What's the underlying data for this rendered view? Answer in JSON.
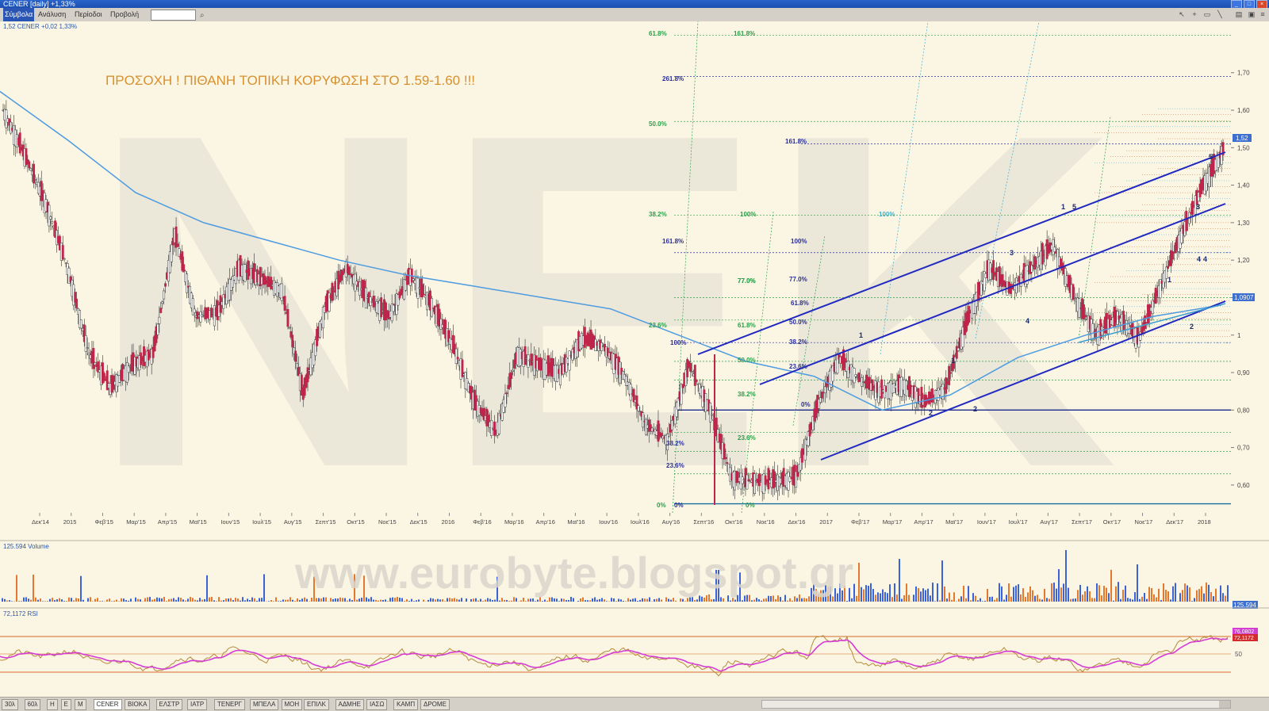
{
  "window": {
    "title": "CENER [daily] +1,33%"
  },
  "menu": {
    "items": [
      "Σύμβολα",
      "Ανάλυση",
      "Περίοδοι",
      "Προβολή"
    ]
  },
  "price_panel": {
    "legend": "1,52 CENER +0,02 1,33%",
    "annotation": "ΠΡΟΣΟΧΗ !    ΠΙΘΑΝΗ ΤΟΠΙΚΗ ΚΟΡΥΦΩΣΗ ΣΤΟ 1.59-1.60 !!!",
    "watermark": "NEK",
    "last_price_tag": "1,52",
    "ma_price_tag": "1,0907"
  },
  "volume_panel": {
    "legend": "125.594 Volume",
    "value_tag": "125.594"
  },
  "rsi_panel": {
    "legend": "72,1172 RSI",
    "value_tag1": "76,0802",
    "value_tag2": "72,1172",
    "axis_label": "50"
  },
  "site_watermark": "www.eurobyte.blogspot.gr",
  "tabs": [
    "30λ",
    "60λ",
    "H",
    "E",
    "M",
    "CENER",
    "ΒΙΟΚΑ",
    "ΕΛΣΤΡ",
    "ΙΑΤΡ",
    "ΤΕΝΕΡΓ",
    "ΜΠΕΛΑ",
    "ΜΟΗ",
    "ΕΠΙΛΚ",
    "ΑΔΜΗΕ",
    "ΙΑΣΩ",
    "ΚΑΜΠ",
    "ΔΡΟΜΕ"
  ],
  "chart_data": {
    "type": "line",
    "price_axis": {
      "ticks": [
        "1,70",
        "1,60",
        "1,50",
        "1,40",
        "1,30",
        "1,20",
        "1,10",
        "1",
        "0,90",
        "0,80",
        "0,70",
        "0,60"
      ],
      "ylim": [
        0.53,
        1.82
      ]
    },
    "x_ticks": [
      "Δεκ'14",
      "2015",
      "Φεβ'15",
      "Μαρ'15",
      "Απρ'15",
      "Μαϊ'15",
      "Ιουν'15",
      "Ιουλ'15",
      "Αυγ'15",
      "Σεπτ'15",
      "Οκτ'15",
      "Νοε'15",
      "Δεκ'15",
      "2016",
      "Φεβ'16",
      "Μαρ'16",
      "Απρ'16",
      "Μαϊ'16",
      "Ιουν'16",
      "Ιουλ'16",
      "Αυγ'16",
      "Σεπτ'16",
      "Οκτ'16",
      "Νοε'16",
      "Δεκ'16",
      "2017",
      "Φεβ'17",
      "Μαρ'17",
      "Απρ'17",
      "Μαϊ'17",
      "Ιουν'17",
      "Ιουλ'17",
      "Αυγ'17",
      "Σεπτ'17",
      "Οκτ'17",
      "Νοε'17",
      "Δεκ'17",
      "2018"
    ],
    "price_series": {
      "name": "CENER",
      "values": [
        1.6,
        1.48,
        1.35,
        1.18,
        0.95,
        0.86,
        0.92,
        0.95,
        1.27,
        1.05,
        1.06,
        1.18,
        1.15,
        1.12,
        0.84,
        1.07,
        1.18,
        1.1,
        1.05,
        1.16,
        1.08,
        0.97,
        0.82,
        0.74,
        0.95,
        0.92,
        0.9,
        0.99,
        0.97,
        0.89,
        0.76,
        0.72,
        0.92,
        0.8,
        0.62,
        0.61,
        0.61,
        0.62,
        0.81,
        0.94,
        0.88,
        0.85,
        0.87,
        0.82,
        0.86,
        1.04,
        1.18,
        1.12,
        1.18,
        1.24,
        1.1,
        1.0,
        1.05,
        0.99,
        1.13,
        1.27,
        1.4,
        1.5
      ]
    },
    "ma_series": {
      "name": "MA",
      "values": [
        1.65,
        1.52,
        1.38,
        1.3,
        1.25,
        1.2,
        1.16,
        1.13,
        1.1,
        1.07,
        1.0,
        0.93,
        0.89,
        0.8,
        0.84,
        0.94,
        1.0,
        1.05,
        1.08
      ]
    },
    "fib_labels": [
      "61.8%",
      "161.8%",
      "261.8%",
      "50.0%",
      "161.8%",
      "38.2%",
      "100%",
      "100%",
      "161.8%",
      "100%",
      "77.0%",
      "77.0%",
      "61.8%",
      "23.6%",
      "61.8%",
      "50.0%",
      "38.2%",
      "100%",
      "0%",
      "23.6%",
      "77.0%",
      "38.2%",
      "50.0%",
      "38.2%",
      "23.6%",
      "23.6%",
      "0%",
      "0%",
      "0%"
    ],
    "wave_labels": [
      "1",
      "2",
      "1",
      "2",
      "3",
      "4",
      "1",
      "5",
      "3",
      "4",
      "5",
      "1",
      "2",
      "3",
      "4"
    ],
    "volume": {
      "type": "bar"
    },
    "rsi": {
      "type": "line",
      "guide_levels": [
        30,
        50,
        70
      ]
    }
  }
}
